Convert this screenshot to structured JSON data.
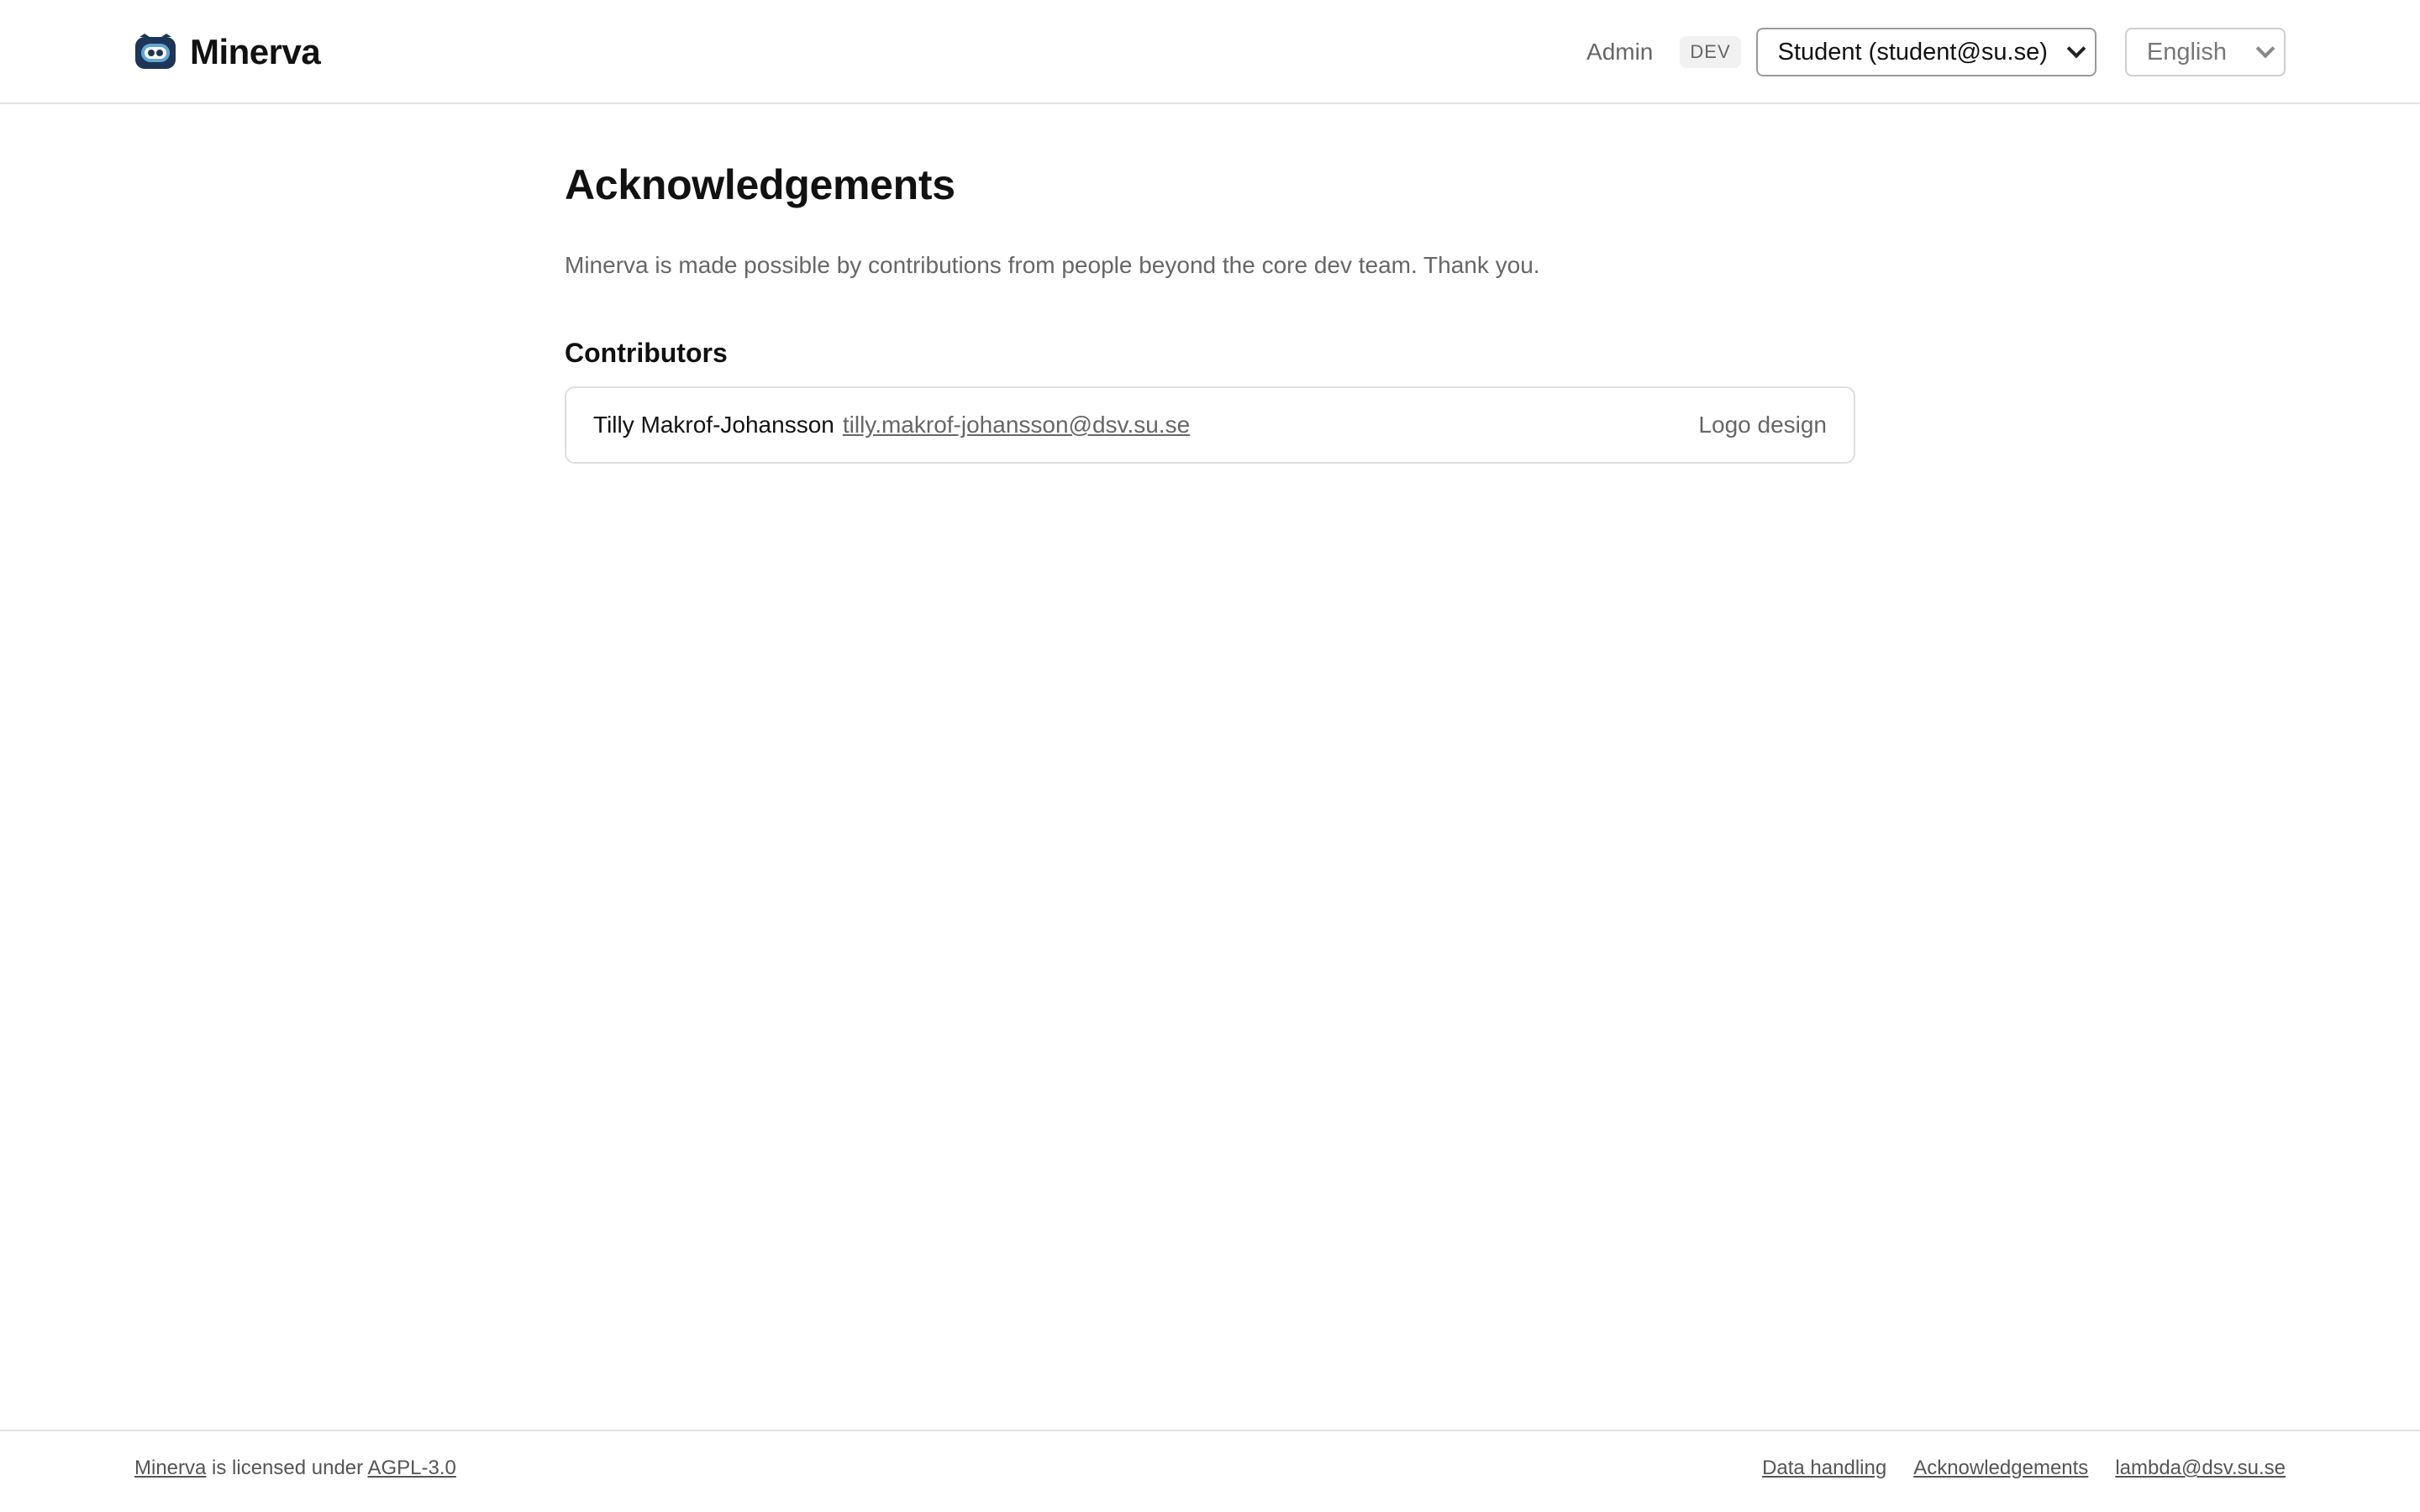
{
  "header": {
    "brand": "Minerva",
    "admin_label": "Admin",
    "env_badge": "DEV",
    "user_select": "Student (student@su.se)",
    "language_select": "English"
  },
  "main": {
    "title": "Acknowledgements",
    "intro": "Minerva is made possible by contributions from people beyond the core dev team. Thank you.",
    "contributors_heading": "Contributors",
    "contributors": [
      {
        "name": "Tilly Makrof-Johansson",
        "email": "tilly.makrof-johansson@dsv.su.se",
        "role": "Logo design"
      }
    ]
  },
  "footer": {
    "project_link": "Minerva",
    "license_text": " is licensed under ",
    "license_link": "AGPL-3.0",
    "links": [
      "Data handling",
      "Acknowledgements",
      "lambda@dsv.su.se"
    ]
  },
  "colors": {
    "logo_dark": "#1d3557",
    "logo_light": "#5fa8d3",
    "text_muted": "#666666",
    "border": "#dedede"
  }
}
